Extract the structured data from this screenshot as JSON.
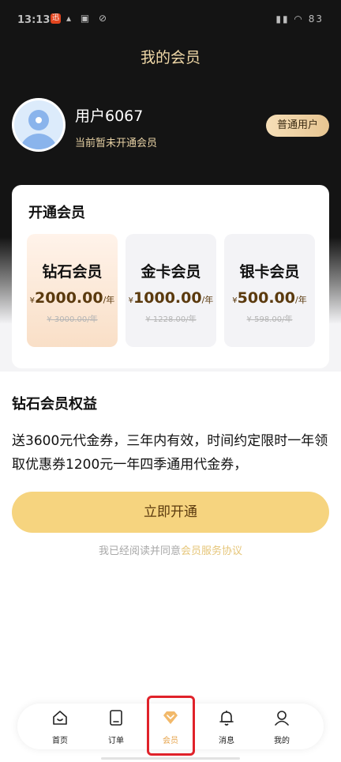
{
  "status_bar": {
    "time": "13:13",
    "app_badge": "迅",
    "battery": "83"
  },
  "header": {
    "title": "我的会员"
  },
  "user": {
    "name": "用户6067",
    "status": "当前暂未开通会员",
    "badge": "普通用户"
  },
  "membership": {
    "title": "开通会员",
    "plans": [
      {
        "name": "钻石会员",
        "currency": "¥",
        "price": "2000.00",
        "unit": "/年",
        "original": "¥ 3000.00/年",
        "selected": true
      },
      {
        "name": "金卡会员",
        "currency": "¥",
        "price": "1000.00",
        "unit": "/年",
        "original": "¥ 1228.00/年",
        "selected": false
      },
      {
        "name": "银卡会员",
        "currency": "¥",
        "price": "500.00",
        "unit": "/年",
        "original": "¥ 598.00/年",
        "selected": false
      }
    ]
  },
  "benefits": {
    "title": "钻石会员权益",
    "text": "送3600元代金券，三年内有效，时间约定限时一年领取优惠券1200元一年四季通用代金券，"
  },
  "cta": {
    "label": "立即开通"
  },
  "agreement": {
    "prefix": "我已经阅读并同意",
    "link": "会员服务协议"
  },
  "tabbar": {
    "tabs": [
      {
        "label": "首页",
        "icon": "home-icon"
      },
      {
        "label": "订单",
        "icon": "order-icon"
      },
      {
        "label": "会员",
        "icon": "diamond-icon",
        "active": true
      },
      {
        "label": "消息",
        "icon": "bell-icon"
      },
      {
        "label": "我的",
        "icon": "user-icon"
      }
    ]
  },
  "colors": {
    "accent": "#f6d47f",
    "highlight": "#e0222a",
    "active_tab": "#e6a44d"
  }
}
